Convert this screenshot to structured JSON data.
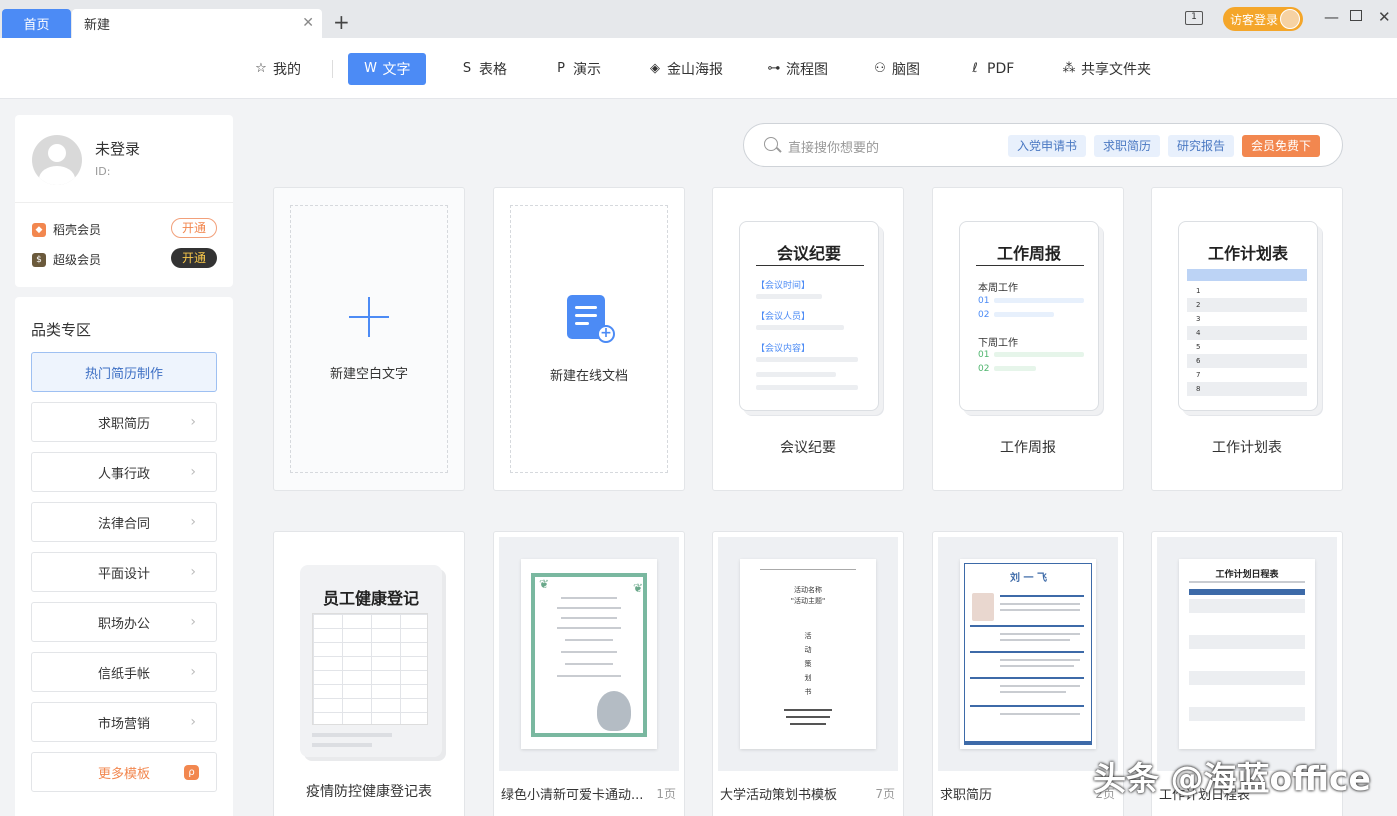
{
  "titlebar": {
    "tabs": [
      {
        "label": "首页"
      },
      {
        "label": "新建"
      }
    ],
    "login_label": "访客登录",
    "box_label": "1"
  },
  "nav": {
    "items": [
      {
        "label": "我的",
        "icon": "star-icon"
      },
      {
        "label": "文字",
        "icon": "writer-icon",
        "active": true
      },
      {
        "label": "表格",
        "icon": "spreadsheet-icon"
      },
      {
        "label": "演示",
        "icon": "presentation-icon"
      },
      {
        "label": "金山海报",
        "icon": "poster-icon"
      },
      {
        "label": "流程图",
        "icon": "flowchart-icon"
      },
      {
        "label": "脑图",
        "icon": "mindmap-icon"
      },
      {
        "label": "PDF",
        "icon": "pdf-icon"
      },
      {
        "label": "共享文件夹",
        "icon": "share-folder-icon"
      }
    ]
  },
  "profile": {
    "name": "未登录",
    "id_label": "ID:",
    "memberships": [
      {
        "label": "稻壳会员",
        "button": "开通",
        "color": "#f2874f"
      },
      {
        "label": "超级会员",
        "button": "开通",
        "color": "#6b5a3c"
      }
    ]
  },
  "categories": {
    "title": "品类专区",
    "items": [
      "热门简历制作",
      "求职简历",
      "人事行政",
      "法律合同",
      "平面设计",
      "职场办公",
      "信纸手帐",
      "市场营销"
    ],
    "more": "更多模板"
  },
  "search": {
    "placeholder": "直接搜你想要的",
    "tags": [
      "入党申请书",
      "求职简历",
      "研究报告"
    ],
    "vip_tag": "会员免费下"
  },
  "cards_top": {
    "blank": "新建空白文字",
    "online": "新建在线文档",
    "meeting": {
      "title": "会议纪要",
      "labels": [
        "【会议时间】",
        "【会议人员】",
        "【会议内容】"
      ],
      "name": "会议纪要"
    },
    "weekly": {
      "title": "工作周报",
      "sec1": "本周工作",
      "sec2": "下周工作",
      "n1": "01",
      "n2": "02",
      "name": "工作周报"
    },
    "plan": {
      "title": "工作计划表",
      "rows": [
        "1",
        "2",
        "3",
        "4",
        "5",
        "6",
        "7",
        "8"
      ],
      "name": "工作计划表"
    }
  },
  "cards_bottom": {
    "health": {
      "title": "员工健康登记",
      "name": "疫情防控健康登记表"
    },
    "green": {
      "name": "绿色小清新可爱卡通动...",
      "pages": "1页"
    },
    "campus": {
      "name": "大学活动策划书模板",
      "pages": "7页",
      "line1": "活动名称",
      "line2": "\"活动主题\"",
      "vertical": [
        "活",
        "动",
        "策",
        "划",
        "书"
      ]
    },
    "resume": {
      "name": "求职简历",
      "pages": "2页",
      "person": "刘 一 飞"
    },
    "schedule": {
      "name": "工作计划日程表",
      "title": "工作计划日程表"
    }
  },
  "watermark": "头条 @海蓝office"
}
